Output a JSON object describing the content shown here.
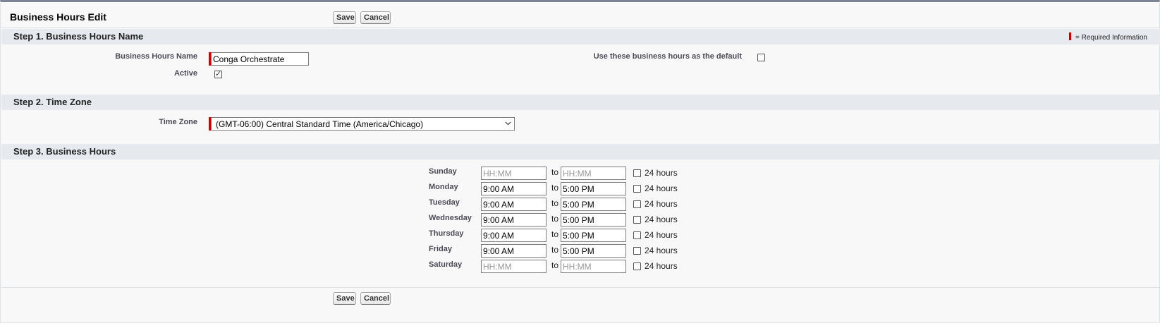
{
  "page": {
    "title": "Business Hours Edit",
    "save_label": "Save",
    "cancel_label": "Cancel",
    "required_legend": "= Required Information"
  },
  "step1": {
    "title": "Step 1. Business Hours Name",
    "name_label": "Business Hours Name",
    "name_value": "Conga Orchestrate",
    "active_label": "Active",
    "active_checked": true,
    "default_label": "Use these business hours as the default",
    "default_checked": false
  },
  "step2": {
    "title": "Step 2. Time Zone",
    "timezone_label": "Time Zone",
    "timezone_value": "(GMT-06:00) Central Standard Time (America/Chicago)"
  },
  "step3": {
    "title": "Step 3. Business Hours",
    "to_label": "to",
    "hours24_label": "24 hours",
    "placeholder": "HH:MM",
    "days": [
      {
        "name": "Sunday",
        "start": "",
        "end": ""
      },
      {
        "name": "Monday",
        "start": "9:00 AM",
        "end": "5:00 PM"
      },
      {
        "name": "Tuesday",
        "start": "9:00 AM",
        "end": "5:00 PM"
      },
      {
        "name": "Wednesday",
        "start": "9:00 AM",
        "end": "5:00 PM"
      },
      {
        "name": "Thursday",
        "start": "9:00 AM",
        "end": "5:00 PM"
      },
      {
        "name": "Friday",
        "start": "9:00 AM",
        "end": "5:00 PM"
      },
      {
        "name": "Saturday",
        "start": "",
        "end": ""
      }
    ]
  },
  "colors": {
    "required": "#cc0000",
    "section_header": "#e6e9ee",
    "page_background": "#f8f8f8"
  },
  "icons": {
    "checkbox_checked": "check-icon",
    "select_arrow": "chevron-down-icon"
  }
}
